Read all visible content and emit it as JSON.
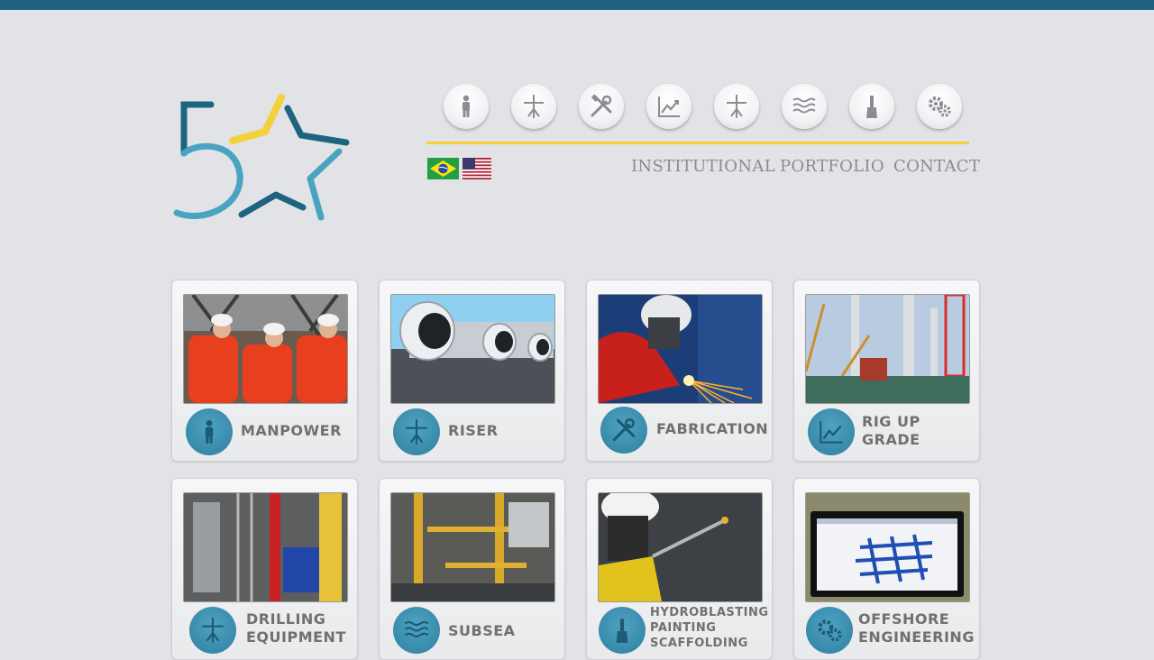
{
  "header": {
    "logo_name": "5-star-logo",
    "icons": [
      {
        "name": "manpower-icon"
      },
      {
        "name": "riser-icon"
      },
      {
        "name": "fabrication-icon"
      },
      {
        "name": "rig-up-grade-icon"
      },
      {
        "name": "drilling-equipment-icon"
      },
      {
        "name": "subsea-icon"
      },
      {
        "name": "painting-icon"
      },
      {
        "name": "offshore-engineering-icon"
      }
    ],
    "languages": [
      "Português (Brasil)",
      "English (US)"
    ],
    "nav": {
      "institutional": "INSTITUTIONAL",
      "portfolio": "PORTFOLIO",
      "contact": "CONTACT"
    }
  },
  "services": [
    {
      "label": "MANPOWER",
      "icon": "manpower-icon"
    },
    {
      "label": "RISER",
      "icon": "riser-icon"
    },
    {
      "label": "FABRICATION",
      "icon": "fabrication-icon"
    },
    {
      "label": "RIG UP\nGRADE",
      "icon": "rig-up-grade-icon"
    },
    {
      "label": "DRILLING\nEQUIPMENT",
      "icon": "drilling-equipment-icon"
    },
    {
      "label": "SUBSEA",
      "icon": "subsea-icon"
    },
    {
      "label": "HYDROBLASTING\nPAINTING\nSCAFFOLDING",
      "icon": "painting-icon"
    },
    {
      "label": "OFFSHORE\nENGINEERING",
      "icon": "offshore-engineering-icon"
    }
  ],
  "colors": {
    "background": "#e2e3e6",
    "top_bar": "#1e6380",
    "accent_yellow": "#f3d13b",
    "logo_blue": "#1e6380",
    "logo_light_blue": "#4aa3c1",
    "icon_circle": "#2e7fa0",
    "label_gray": "#707070",
    "nav_gray": "#8c8c8c"
  }
}
